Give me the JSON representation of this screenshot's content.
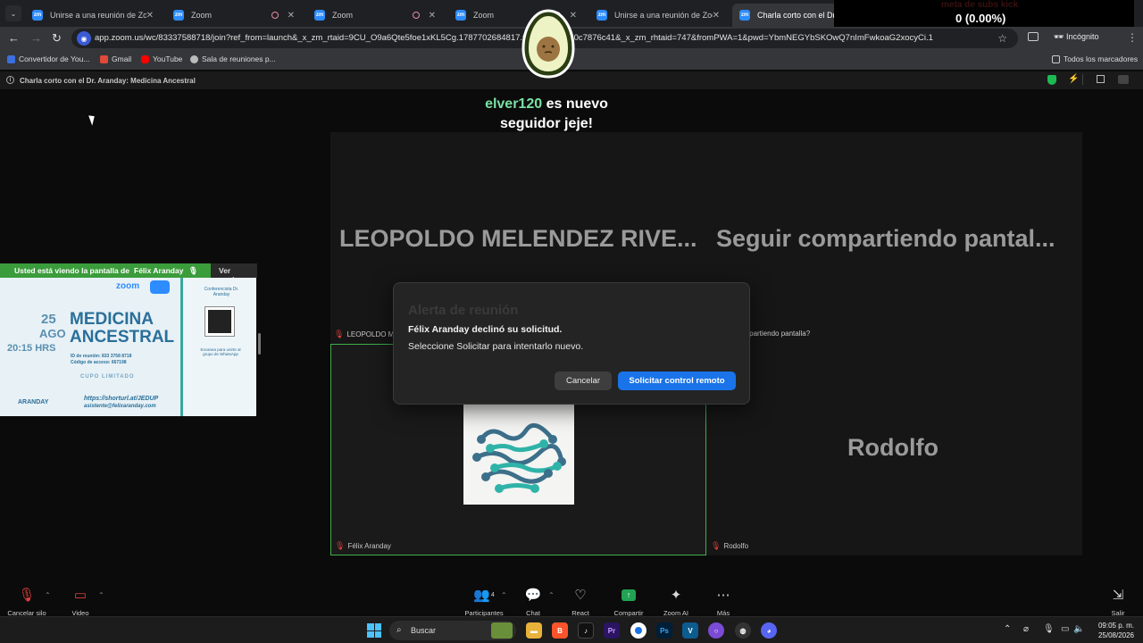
{
  "browser": {
    "tabs": [
      {
        "title": "Unirse a una reunión de Zoom",
        "recording": false
      },
      {
        "title": "Zoom",
        "recording": true
      },
      {
        "title": "Zoom",
        "recording": true
      },
      {
        "title": "Zoom",
        "recording": true
      },
      {
        "title": "Unirse a una reunión de Zoom",
        "recording": false
      },
      {
        "title": "Charla corto con el Dr. Ara",
        "recording": true,
        "active": true
      }
    ],
    "url": "app.zoom.us/wc/83337588718/join?ref_from=launch&_x_zm_rtaid=9CU_O9a6Qte5foe1xKL5Cg.1787702684817.621d8ca56860c7876c41&_x_zm_rhtaid=747&fromPWA=1&pwd=YbmNEGYbSKOwQ7nImFwkoaG2xocyCi.1",
    "incognito_label": "Incógnito",
    "bookmarks": [
      "Convertidor de You...",
      "Gmail",
      "YouTube",
      "Sala de reuniones p..."
    ],
    "all_bookmarks": "Todos los marcadores"
  },
  "overlay": {
    "subs_title": "meta de subs kick",
    "subs_count": "0 (0.00%)",
    "follower_name": "elver120",
    "follower_text_1": "es nuevo",
    "follower_text_2": "seguidor jeje!"
  },
  "meeting": {
    "title": "Charla corto con el Dr. Aranday: Medicina Ancestral",
    "participants": {
      "leopoldo_name": "LEOPOLDO MELENDEZ RIVE...",
      "leopoldo_label": "LEOPOLDO MEL",
      "seguir_name": "Seguir compartiendo pantal...",
      "seguir_label": "ompartiendo pantalla?",
      "felix_label": "Félix Aranday",
      "rodolfo_name": "Rodolfo",
      "rodolfo_label": "Rodolfo"
    },
    "share_banner": "Usted está viendo la pantalla de",
    "share_presenter": "Félix Aranday",
    "share_options": "Ver opcion",
    "flyer": {
      "zoom": "zoom",
      "day": "25",
      "month": "AGO",
      "time": "20:15 HRS",
      "heading_1": "MEDICINA",
      "heading_2": "ANCESTRAL",
      "id_line": "ID de reunión: 833 3758 8718",
      "code_line": "Código de acceso: 667198",
      "limit": "CUPO LIMITADO",
      "link": "https://shorturl.at/JEDUP",
      "email": "asistente@felixaranday.com",
      "right_title": "Conferencista Dr. Aranday",
      "right_note": "Escanea para unirte al grupo de WhatsApp",
      "brand": "ARANDAY"
    }
  },
  "dialog": {
    "ghost_title": "Alerta de reunión",
    "message_1": "Félix Aranday declinó su solicitud.",
    "message_2": "Seleccione Solicitar para intentarlo nuevo.",
    "cancel": "Cancelar",
    "request": "Solicitar control remoto"
  },
  "toolbar": {
    "mute": "Cancelar silo",
    "video": "Video",
    "participants": "Participantes",
    "participants_count": "4",
    "chat": "Chat",
    "react": "React",
    "share": "Compartir",
    "ai": "Zoom AI",
    "more": "Más",
    "leave": "Salir"
  },
  "taskbar": {
    "search": "Buscar",
    "time": "09:05 p. m.",
    "date": "25/08/2026"
  }
}
